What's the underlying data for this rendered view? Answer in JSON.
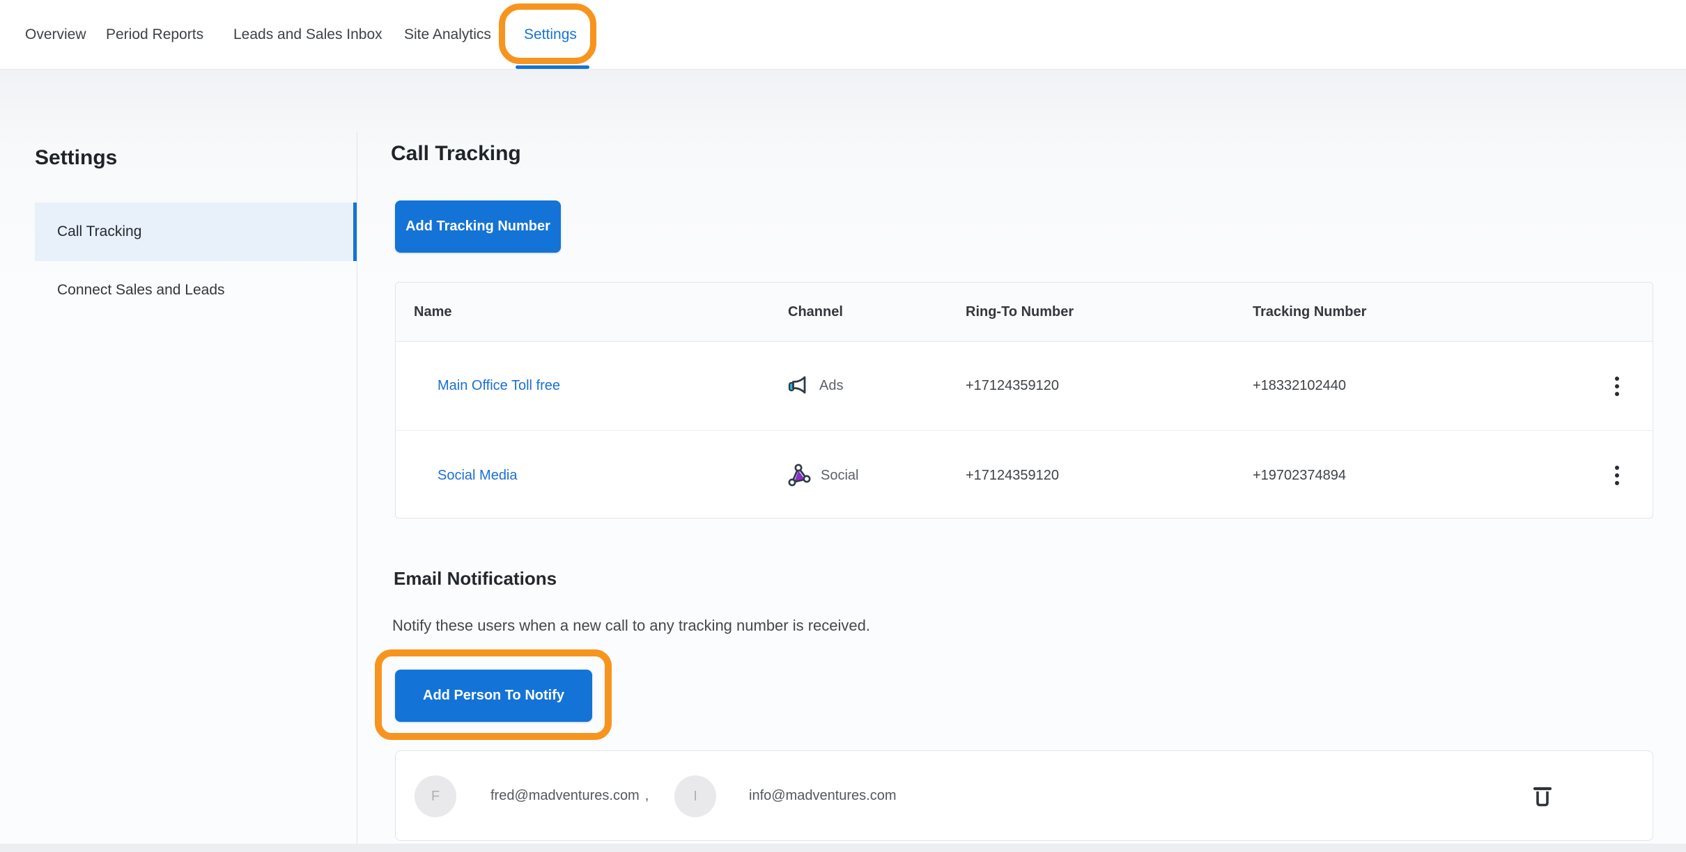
{
  "nav": {
    "items": [
      {
        "label": "Overview",
        "active": false
      },
      {
        "label": "Period Reports",
        "active": false
      },
      {
        "label": "Leads and Sales Inbox",
        "active": false
      },
      {
        "label": "Site Analytics",
        "active": false
      },
      {
        "label": "Settings",
        "active": true
      }
    ]
  },
  "sidebar": {
    "title": "Settings",
    "items": [
      {
        "label": "Call Tracking",
        "selected": true
      },
      {
        "label": "Connect Sales and Leads",
        "selected": false
      }
    ]
  },
  "call_tracking": {
    "title": "Call Tracking",
    "add_button_label": "Add Tracking Number",
    "table": {
      "columns": [
        "Name",
        "Channel",
        "Ring-To Number",
        "Tracking Number"
      ],
      "rows": [
        {
          "name": "Main Office Toll free",
          "channel": "Ads",
          "channel_icon": "megaphone-icon",
          "ring_to_number": "+17124359120",
          "tracking_number": "+18332102440"
        },
        {
          "name": "Social Media",
          "channel": "Social",
          "channel_icon": "share-nodes-icon",
          "ring_to_number": "+17124359120",
          "tracking_number": "+19702374894"
        }
      ]
    }
  },
  "email_notifications": {
    "title": "Email Notifications",
    "description": "Notify these users when a new call to any tracking number is received.",
    "add_button_label": "Add Person To Notify",
    "separator": ",",
    "recipients": [
      {
        "initial": "F",
        "email": "fred@madventures.com"
      },
      {
        "initial": "I",
        "email": "info@madventures.com"
      }
    ]
  },
  "colors": {
    "primary_blue": "#1473D6",
    "active_tab_blue": "#1673D4",
    "link_blue": "#1A6FD4",
    "annotation_orange": "#F7941E",
    "selected_item_bg": "#E8F1FA",
    "social_icon_purple": "#8B2FC9",
    "megaphone_accent_teal": "#29B6D8"
  }
}
